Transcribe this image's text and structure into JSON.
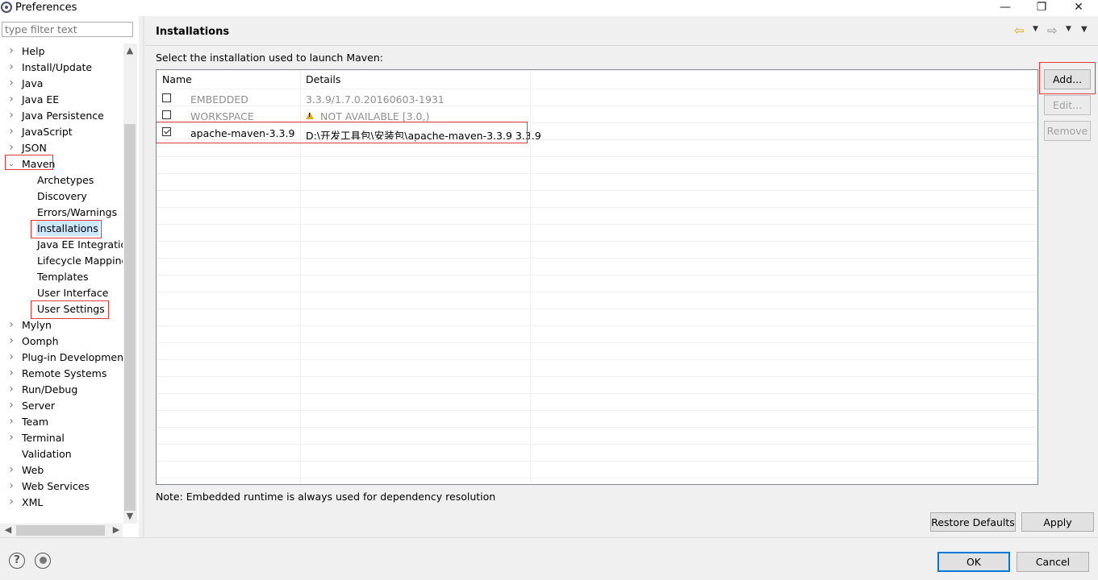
{
  "window": {
    "title": "Preferences",
    "minimize": "—",
    "restore": "❐",
    "close": "✕"
  },
  "left": {
    "filter_placeholder": "type filter text",
    "tree": [
      {
        "label": "Help",
        "level": 0,
        "twisty": "›"
      },
      {
        "label": "Install/Update",
        "level": 0,
        "twisty": "›"
      },
      {
        "label": "Java",
        "level": 0,
        "twisty": "›"
      },
      {
        "label": "Java EE",
        "level": 0,
        "twisty": "›"
      },
      {
        "label": "Java Persistence",
        "level": 0,
        "twisty": "›"
      },
      {
        "label": "JavaScript",
        "level": 0,
        "twisty": "›"
      },
      {
        "label": "JSON",
        "level": 0,
        "twisty": "›"
      },
      {
        "label": "Maven",
        "level": 0,
        "twisty": "⌄",
        "expanded": true,
        "highlight": true
      },
      {
        "label": "Archetypes",
        "level": 1
      },
      {
        "label": "Discovery",
        "level": 1
      },
      {
        "label": "Errors/Warnings",
        "level": 1
      },
      {
        "label": "Installations",
        "level": 1,
        "selected": true,
        "highlight": true
      },
      {
        "label": "Java EE Integration",
        "level": 1
      },
      {
        "label": "Lifecycle Mapping",
        "level": 1
      },
      {
        "label": "Templates",
        "level": 1
      },
      {
        "label": "User Interface",
        "level": 1
      },
      {
        "label": "User Settings",
        "level": 1,
        "highlight": true
      },
      {
        "label": "Mylyn",
        "level": 0,
        "twisty": "›"
      },
      {
        "label": "Oomph",
        "level": 0,
        "twisty": "›"
      },
      {
        "label": "Plug-in Development",
        "level": 0,
        "twisty": "›"
      },
      {
        "label": "Remote Systems",
        "level": 0,
        "twisty": "›"
      },
      {
        "label": "Run/Debug",
        "level": 0,
        "twisty": "›"
      },
      {
        "label": "Server",
        "level": 0,
        "twisty": "›"
      },
      {
        "label": "Team",
        "level": 0,
        "twisty": "›"
      },
      {
        "label": "Terminal",
        "level": 0,
        "twisty": "›"
      },
      {
        "label": "Validation",
        "level": 0
      },
      {
        "label": "Web",
        "level": 0,
        "twisty": "›"
      },
      {
        "label": "Web Services",
        "level": 0,
        "twisty": "›"
      },
      {
        "label": "XML",
        "level": 0,
        "twisty": "›"
      }
    ]
  },
  "page": {
    "title": "Installations",
    "instruction": "Select the installation used to launch Maven:",
    "columns": [
      "Name",
      "Details"
    ],
    "rows": [
      {
        "checked": false,
        "name": "EMBEDDED",
        "details": "3.3.9/1.7.0.20160603-1931",
        "dim": true,
        "warning": false
      },
      {
        "checked": false,
        "name": "WORKSPACE",
        "details": "NOT AVAILABLE [3.0,)",
        "dim": true,
        "warning": true
      },
      {
        "checked": true,
        "name": "apache-maven-3.3.9",
        "details": "D:\\开发工具包\\安装包\\apache-maven-3.3.9 3.3.9",
        "dim": false,
        "warning": false
      }
    ],
    "note": "Note: Embedded runtime is always used for dependency resolution",
    "buttons": {
      "add": "Add...",
      "edit": "Edit...",
      "remove": "Remove",
      "restore": "Restore Defaults",
      "apply": "Apply"
    }
  },
  "footer": {
    "ok": "OK",
    "cancel": "Cancel",
    "help_glyph": "?"
  },
  "colors": {
    "selection": "#cce8ff",
    "highlight_box": "#e23a3a",
    "default_button": "#0078d7"
  }
}
